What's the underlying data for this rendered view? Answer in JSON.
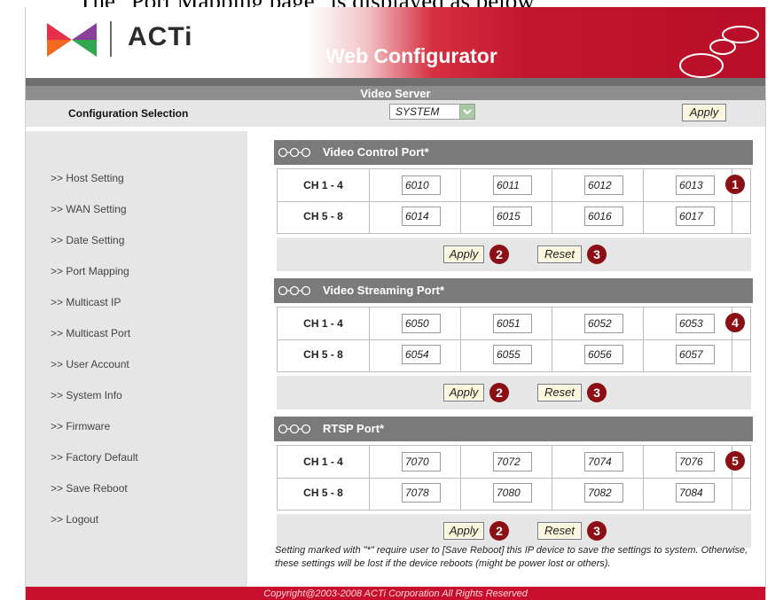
{
  "caption": "The \"Port Mapping page\" is displayed as below",
  "header": {
    "brand": "ACTi",
    "title": "Web Configurator",
    "subtitle": "Video Server"
  },
  "config": {
    "label": "Configuration Selection",
    "selected": "SYSTEM",
    "apply_label": "Apply"
  },
  "sidebar": {
    "items": [
      {
        "label": ">> Host Setting"
      },
      {
        "label": ">> WAN Setting"
      },
      {
        "label": ">> Date Setting"
      },
      {
        "label": ">> Port Mapping"
      },
      {
        "label": ">> Multicast IP"
      },
      {
        "label": ">> Multicast Port"
      },
      {
        "label": ">> User Account"
      },
      {
        "label": ">> System Info"
      },
      {
        "label": ">> Firmware"
      },
      {
        "label": ">> Factory Default"
      },
      {
        "label": ">> Save Reboot"
      },
      {
        "label": ">> Logout"
      }
    ]
  },
  "sections": [
    {
      "title": "Video Control Port*",
      "rows": [
        {
          "label": "CH 1 - 4",
          "ports": [
            "6010",
            "6011",
            "6012",
            "6013"
          ]
        },
        {
          "label": "CH 5 - 8",
          "ports": [
            "6014",
            "6015",
            "6016",
            "6017"
          ]
        }
      ],
      "badge": "1",
      "apply_label": "Apply",
      "apply_badge": "2",
      "reset_label": "Reset",
      "reset_badge": "3"
    },
    {
      "title": "Video Streaming Port*",
      "rows": [
        {
          "label": "CH 1 - 4",
          "ports": [
            "6050",
            "6051",
            "6052",
            "6053"
          ]
        },
        {
          "label": "CH 5 - 8",
          "ports": [
            "6054",
            "6055",
            "6056",
            "6057"
          ]
        }
      ],
      "badge": "4",
      "apply_label": "Apply",
      "apply_badge": "2",
      "reset_label": "Reset",
      "reset_badge": "3"
    },
    {
      "title": "RTSP Port*",
      "rows": [
        {
          "label": "CH 1 - 4",
          "ports": [
            "7070",
            "7072",
            "7074",
            "7076"
          ]
        },
        {
          "label": "CH 5 - 8",
          "ports": [
            "7078",
            "7080",
            "7082",
            "7084"
          ]
        }
      ],
      "badge": "5",
      "apply_label": "Apply",
      "apply_badge": "2",
      "reset_label": "Reset",
      "reset_badge": "3"
    }
  ],
  "footnote": "Setting marked with \"*\" require user to [Save Reboot] this IP device to save the settings to system. Otherwise, these settings will be lost if the device reboots (might be power lost or others).",
  "footer": "Copyright@2003-2008 ACTi Corporation All Rights Reserved",
  "icons": {
    "logo": "acti-logo-icon",
    "rings": "decorative-rings-icon",
    "chain": "chain-link-icon",
    "dropdown": "chevron-down-icon"
  },
  "colors": {
    "header_red": "#c41530",
    "band_gray": "#8e8e8e",
    "section_gray": "#7a7a7a",
    "panel_gray": "#e6e6e6",
    "badge": "#8b0f14",
    "button_bg": "#fbf6dc",
    "footer_red": "#c8102e"
  }
}
